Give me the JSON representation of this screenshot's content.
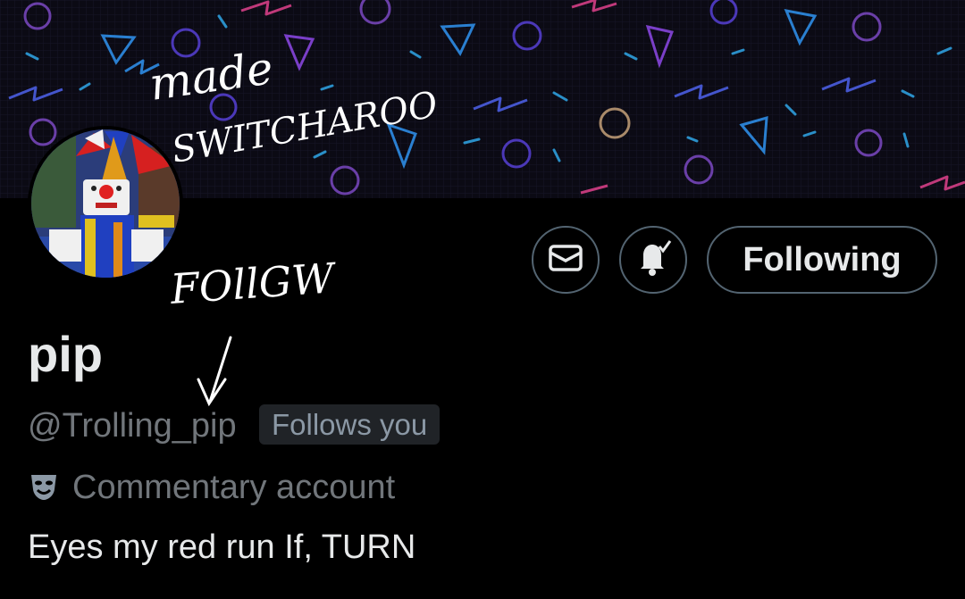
{
  "profile": {
    "display_name": "pip",
    "handle": "@Trolling_pip",
    "follows_you_badge": "Follows you",
    "category": "Commentary account",
    "category_icon": "theater-masks-icon",
    "bio": "Eyes my red run If, TURN"
  },
  "actions": {
    "message_icon": "envelope-icon",
    "notifications_icon": "bell-check-icon",
    "following_label": "Following"
  },
  "overlay_text": {
    "line1": "made",
    "line2": "SWITCHAROO",
    "line3": "FOllGW"
  },
  "colors": {
    "background": "#000000",
    "text_primary": "#e7e9ea",
    "text_secondary": "#71767b",
    "border": "#536471",
    "badge_bg": "#202327"
  }
}
